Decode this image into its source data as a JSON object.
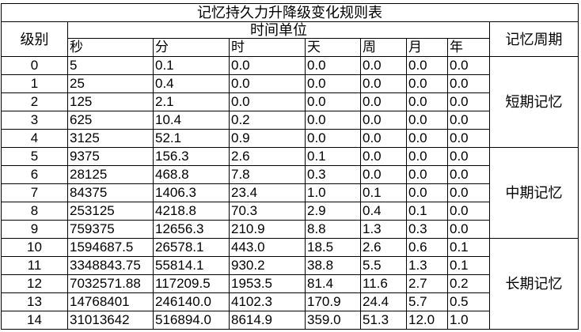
{
  "title": "记忆持久力升降级变化规则表",
  "header": {
    "level": "级别",
    "time_unit": "时间单位",
    "cycle": "记忆周期",
    "units": [
      "秒",
      "分",
      "时",
      "天",
      "周",
      "月",
      "年"
    ]
  },
  "rows": [
    {
      "level": "0",
      "values": [
        "5",
        "0.1",
        "0.0",
        "0.0",
        "0.0",
        "0.0",
        "0.0"
      ]
    },
    {
      "level": "1",
      "values": [
        "25",
        "0.4",
        "0.0",
        "0.0",
        "0.0",
        "0.0",
        "0.0"
      ]
    },
    {
      "level": "2",
      "values": [
        "125",
        "2.1",
        "0.0",
        "0.0",
        "0.0",
        "0.0",
        "0.0"
      ]
    },
    {
      "level": "3",
      "values": [
        "625",
        "10.4",
        "0.2",
        "0.0",
        "0.0",
        "0.0",
        "0.0"
      ]
    },
    {
      "level": "4",
      "values": [
        "3125",
        "52.1",
        "0.9",
        "0.0",
        "0.0",
        "0.0",
        "0.0"
      ]
    },
    {
      "level": "5",
      "values": [
        "9375",
        "156.3",
        "2.6",
        "0.1",
        "0.0",
        "0.0",
        "0.0"
      ]
    },
    {
      "level": "6",
      "values": [
        "28125",
        "468.8",
        "7.8",
        "0.3",
        "0.0",
        "0.0",
        "0.0"
      ]
    },
    {
      "level": "7",
      "values": [
        "84375",
        "1406.3",
        "23.4",
        "1.0",
        "0.1",
        "0.0",
        "0.0"
      ]
    },
    {
      "level": "8",
      "values": [
        "253125",
        "4218.8",
        "70.3",
        "2.9",
        "0.4",
        "0.1",
        "0.0"
      ]
    },
    {
      "level": "9",
      "values": [
        "759375",
        "12656.3",
        "210.9",
        "8.8",
        "1.3",
        "0.3",
        "0.0"
      ]
    },
    {
      "level": "10",
      "values": [
        "1594687.5",
        "26578.1",
        "443.0",
        "18.5",
        "2.6",
        "0.6",
        "0.1"
      ]
    },
    {
      "level": "11",
      "values": [
        "3348843.75",
        "55814.1",
        "930.2",
        "38.8",
        "5.5",
        "1.3",
        "0.1"
      ]
    },
    {
      "level": "12",
      "values": [
        "7032571.88",
        "117209.5",
        "1953.5",
        "81.4",
        "11.6",
        "2.7",
        "0.2"
      ]
    },
    {
      "level": "13",
      "values": [
        "14768401",
        "246140.0",
        "4102.3",
        "170.9",
        "24.4",
        "5.7",
        "0.5"
      ]
    },
    {
      "level": "14",
      "values": [
        "31013642",
        "516894.0",
        "8614.9",
        "359.0",
        "51.3",
        "12.0",
        "1.0"
      ]
    }
  ],
  "groups": [
    {
      "label": "短期记忆",
      "span": 5
    },
    {
      "label": "中期记忆",
      "span": 5
    },
    {
      "label": "长期记忆",
      "span": 5
    }
  ]
}
